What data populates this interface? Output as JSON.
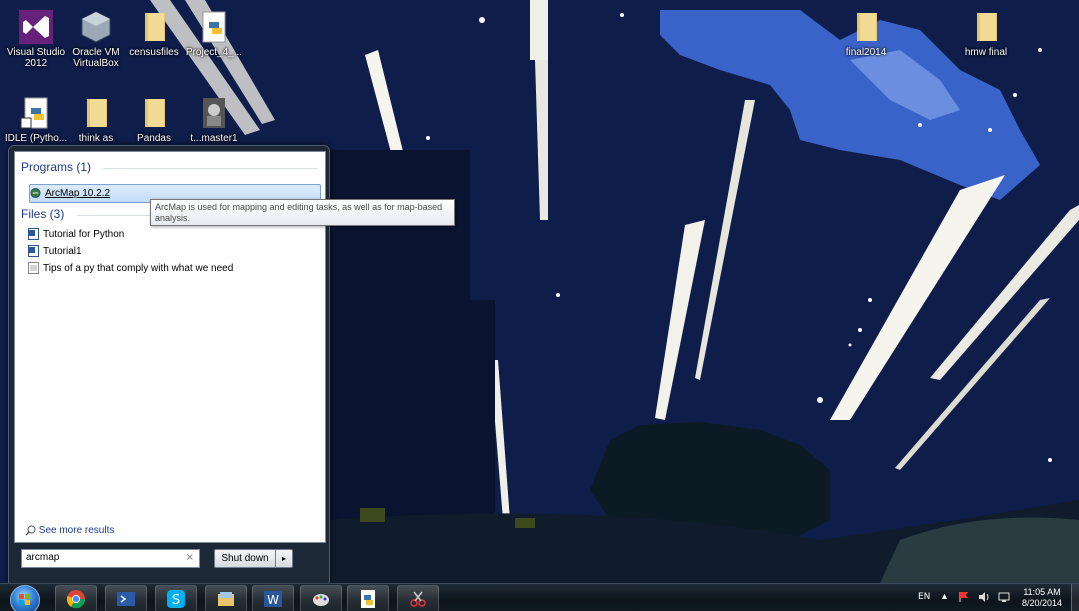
{
  "desktop": {
    "icons": [
      {
        "label": "Visual Studio 2012",
        "icon": "visual-studio-icon"
      },
      {
        "label": "Oracle VM VirtualBox",
        "icon": "virtualbox-icon"
      },
      {
        "label": "censusfiles",
        "icon": "folder-icon"
      },
      {
        "label": "Project_4_...",
        "icon": "python-file-icon"
      },
      {
        "label": "IDLE (Pytho...",
        "icon": "idle-shortcut-icon"
      },
      {
        "label": "think as",
        "icon": "folder-icon"
      },
      {
        "label": "Pandas",
        "icon": "folder-icon"
      },
      {
        "label": "t...master1",
        "icon": "image-icon"
      },
      {
        "label": "final2014",
        "icon": "folder-icon"
      },
      {
        "label": "hmw final",
        "icon": "folder-icon"
      }
    ]
  },
  "start_menu": {
    "programs_header": "Programs (1)",
    "programs": [
      {
        "label": "ArcMap 10.2.2",
        "icon": "arcmap-icon"
      }
    ],
    "files_header": "Files (3)",
    "files": [
      {
        "label": "Tutorial for Python",
        "icon": "word-doc-icon"
      },
      {
        "label": "Tutorial1",
        "icon": "word-doc-icon"
      },
      {
        "label": "Tips of a py that comply with what we need",
        "icon": "text-file-icon"
      }
    ],
    "see_more": "See more results",
    "search_value": "arcmap",
    "search_clear": "×",
    "shutdown_label": "Shut down",
    "shutdown_arrow": "▸",
    "tooltip": "ArcMap is used for mapping and editing tasks, as well as for map-based analysis."
  },
  "taskbar": {
    "pinned": [
      "chrome-icon",
      "powershell-icon",
      "skype-icon",
      "explorer-icon",
      "word-icon",
      "paint-icon",
      "python-icon",
      "snipping-tool-icon"
    ],
    "tray": {
      "language": "EN",
      "show_hidden": "▴",
      "time": "11:05 AM",
      "date": "8/20/2014"
    }
  },
  "colors": {
    "sky": "#0f1d4a",
    "accent": "#1e3a8c",
    "taskbar": "#0d141b"
  }
}
